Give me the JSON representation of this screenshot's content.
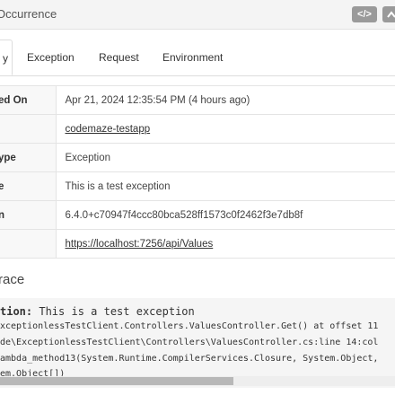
{
  "header": {
    "title": "Occurrence",
    "code_button_label": "</>"
  },
  "tabs": [
    {
      "label": "y"
    },
    {
      "label": "Exception"
    },
    {
      "label": "Request"
    },
    {
      "label": "Environment"
    }
  ],
  "details": [
    {
      "label": "ed On",
      "value": "Apr 21, 2024 12:35:54 PM (4 hours ago)"
    },
    {
      "label": "",
      "value": "codemaze-testapp"
    },
    {
      "label": "ype",
      "value": "Exception"
    },
    {
      "label": "e",
      "value": "This is a test exception"
    },
    {
      "label": "n",
      "value": "6.4.0+c70947f4ccc80bca528ff1573c0f2462f3e7db8f"
    },
    {
      "label": "",
      "value": "https://localhost:7256/api/Values"
    }
  ],
  "stack_trace": {
    "title": "race",
    "exception_type": "tion:",
    "message": " This is a test exception",
    "frames": [
      "xceptionlessTestClient.Controllers.ValuesController.Get() at offset 11",
      "de\\ExceptionlessTestClient\\Controllers\\ValuesController.cs:line 14:col",
      "ambda_method13(System.Runtime.CompilerServices.Closure, System.Object,",
      "em.Object[])"
    ]
  },
  "colors": {
    "header_bg": "#f4f4f4",
    "button_bg": "#9a9a9a",
    "label_bg": "#f8f8f8",
    "stack_bg": "#f5f5f5"
  }
}
